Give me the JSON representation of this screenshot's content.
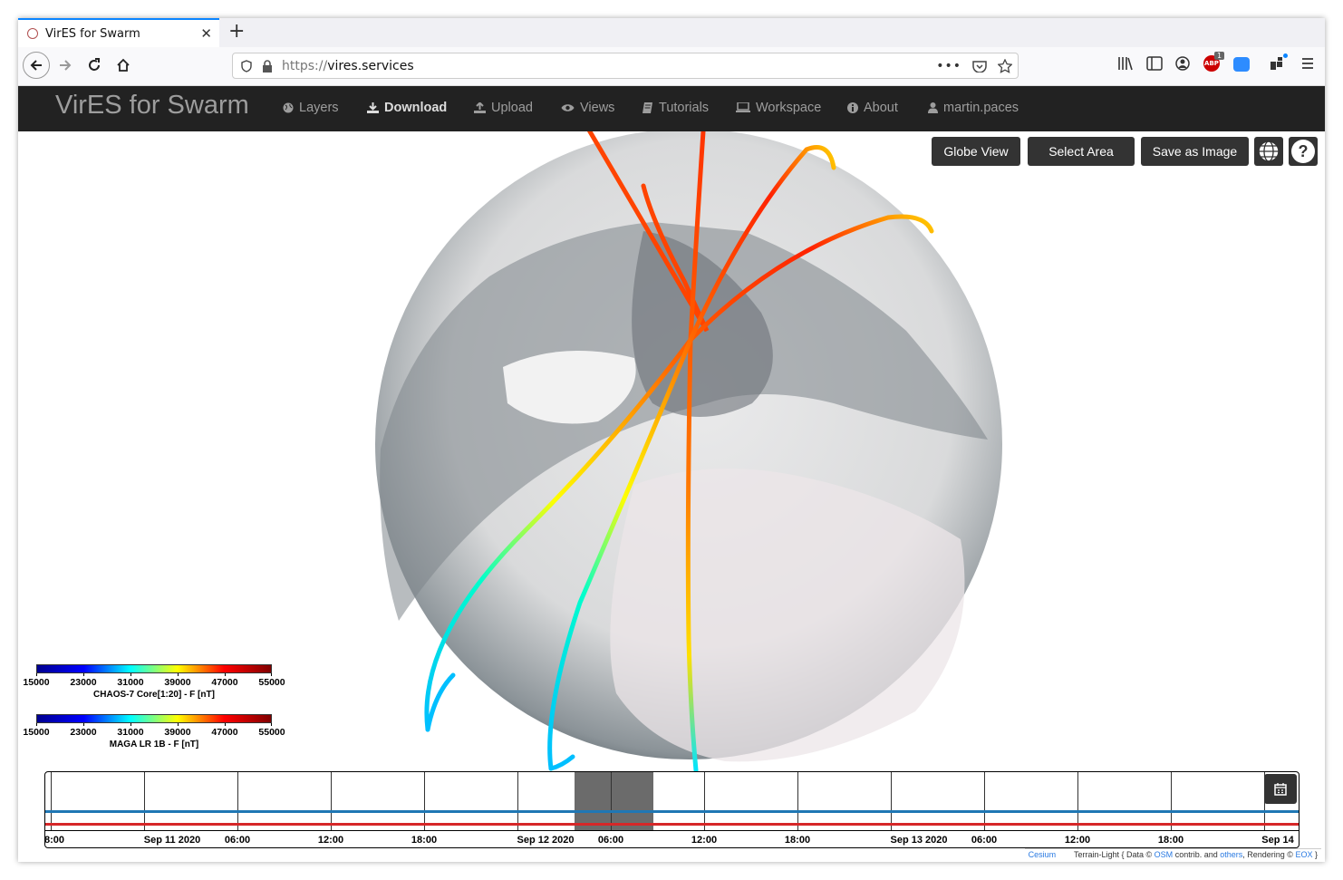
{
  "browser": {
    "tab_title": "VirES for Swarm",
    "tab_close": "✕",
    "new_tab": "+",
    "url_protocol": "https://",
    "url_host": "vires.services",
    "adblock_badge": "1"
  },
  "app": {
    "brand": "VirES for Swarm",
    "menu": [
      {
        "label": "Layers",
        "icon": "globe-icon"
      },
      {
        "label": "Download",
        "icon": "download-icon"
      },
      {
        "label": "Upload",
        "icon": "upload-icon"
      },
      {
        "label": "Views",
        "icon": "eye-icon"
      },
      {
        "label": "Tutorials",
        "icon": "book-icon"
      },
      {
        "label": "Workspace",
        "icon": "laptop-icon"
      },
      {
        "label": "About",
        "icon": "info-icon"
      },
      {
        "label": "martin.paces",
        "icon": "user-icon"
      }
    ],
    "active_menu": "Download"
  },
  "map_controls": {
    "globe_view": "Globe View",
    "select_area": "Select Area",
    "save_image": "Save as Image",
    "help": "?"
  },
  "legends": [
    {
      "title": "CHAOS-7 Core[1:20] - F [nT]",
      "ticks": [
        "15000",
        "23000",
        "31000",
        "39000",
        "47000",
        "55000"
      ]
    },
    {
      "title": "MAGA LR 1B - F [nT]",
      "ticks": [
        "15000",
        "23000",
        "31000",
        "39000",
        "47000",
        "55000"
      ]
    }
  ],
  "timeline": {
    "labels": [
      "8:00",
      "Sep 11 2020",
      "06:00",
      "12:00",
      "18:00",
      "Sep 12 2020",
      "06:00",
      "12:00",
      "18:00",
      "Sep 13 2020",
      "06:00",
      "12:00",
      "18:00",
      "Sep 14"
    ],
    "series_colors": {
      "blue": "#1f77b4",
      "red": "#d62728"
    }
  },
  "credits": {
    "cesium": "Cesium",
    "text1": "Terrain-Light { Data ©",
    "osm": "OSM",
    "text2": "contrib. and",
    "others": "others",
    "text3": ", Rendering ©",
    "eox": "EOX",
    "text4": "}"
  }
}
